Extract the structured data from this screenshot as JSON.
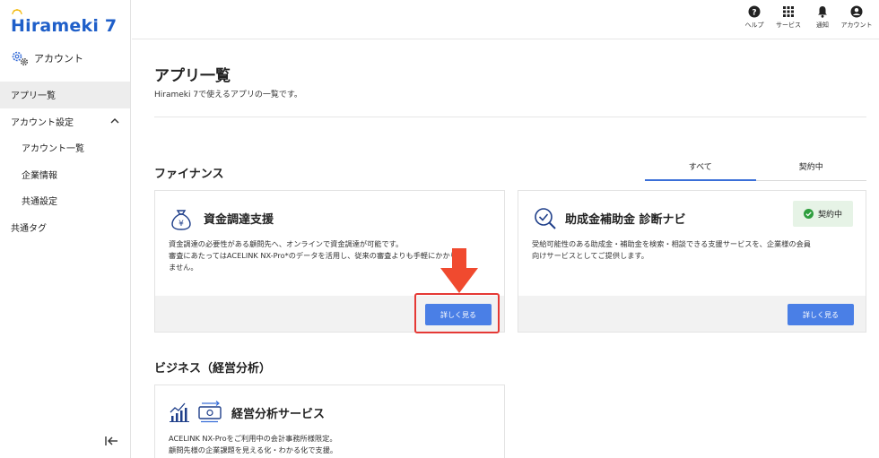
{
  "app": {
    "logo_text": "Hirameki 7"
  },
  "sidebar": {
    "account_label": "アカウント",
    "items": [
      {
        "label": "アプリ一覧"
      },
      {
        "label": "アカウント設定"
      },
      {
        "label": "アカウント一覧"
      },
      {
        "label": "企業情報"
      },
      {
        "label": "共通設定"
      },
      {
        "label": "共通タグ"
      }
    ]
  },
  "topbar": {
    "help": "ヘルプ",
    "services": "サービス",
    "notifications": "通知",
    "account": "アカウント"
  },
  "main": {
    "title": "アプリ一覧",
    "subtitle": "Hirameki 7で使えるアプリの一覧です。",
    "finance_section": "ファイナンス",
    "business_section": "ビジネス（経営分析）",
    "tabs": [
      {
        "label": "すべて"
      },
      {
        "label": "契約中"
      }
    ],
    "cards": {
      "funding": {
        "title": "資金調達支援",
        "desc_line1": "資金調達の必要性がある顧問先へ、オンラインで資金調達が可能です。",
        "desc_line2": "審査にあたってはACELINK NX-Pro*のデータを活用し、従来の審査よりも手軽にかかり",
        "desc_line3": "ません。",
        "button": "詳しく見る"
      },
      "subsidy": {
        "title": "助成金補助金 診断ナビ",
        "desc_line1": "受給可能性のある助成金・補助金を検索・相談できる支援サービスを、企業様の会員",
        "desc_line2": "向けサービスとしてご提供します。",
        "badge": "契約中",
        "button": "詳しく見る"
      },
      "analysis": {
        "title": "経営分析サービス",
        "desc_line1": "ACELINK NX-Proをご利用中の会計事務所様限定。",
        "desc_line2": "顧問先様の企業課題を見える化・わかる化で支援。"
      }
    }
  },
  "colors": {
    "brand": "#1f5fc9",
    "button": "#4a7fe6",
    "highlight": "#e53935",
    "badge_bg": "#e6f3e6",
    "badge_icon": "#2e9e3e"
  }
}
